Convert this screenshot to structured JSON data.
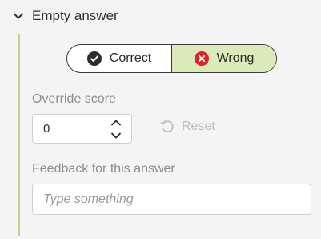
{
  "section": {
    "title": "Empty answer",
    "expand_icon": "chevron-down-icon"
  },
  "toggle": {
    "correct_label": "Correct",
    "correct_icon": "check-circle-icon",
    "wrong_label": "Wrong",
    "wrong_icon": "x-circle-icon",
    "selected": "Wrong",
    "selected_color": "#dbeab8",
    "wrong_icon_color": "#e0202e"
  },
  "override_score": {
    "label": "Override score",
    "value": "0",
    "stepper_icon": "up-down-chevrons-icon"
  },
  "reset": {
    "label": "Reset",
    "icon": "reset-arrow-icon"
  },
  "feedback": {
    "label": "Feedback for this answer",
    "placeholder": "Type something",
    "value": ""
  },
  "colors": {
    "accent_line": "#bcd58a",
    "background": "#f4f4f4"
  }
}
